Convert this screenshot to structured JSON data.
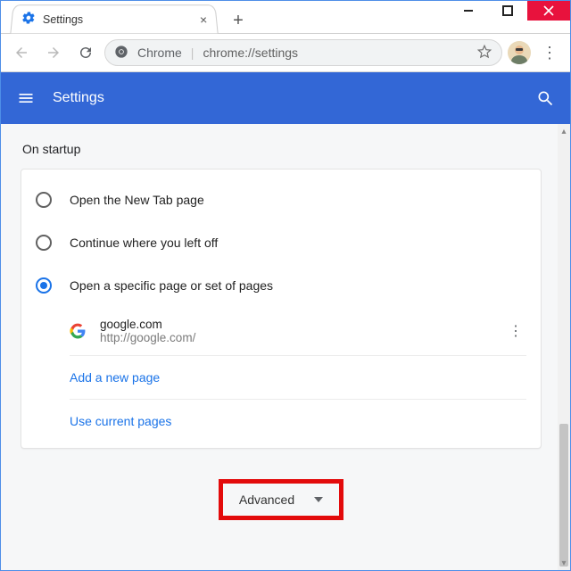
{
  "window": {
    "tab_title": "Settings"
  },
  "omnibox": {
    "scheme_label": "Chrome",
    "url": "chrome://settings"
  },
  "header": {
    "title": "Settings"
  },
  "section": {
    "title": "On startup",
    "options": [
      "Open the New Tab page",
      "Continue where you left off",
      "Open a specific page or set of pages"
    ],
    "startup_page": {
      "name": "google.com",
      "url": "http://google.com/"
    },
    "add_page": "Add a new page",
    "use_current": "Use current pages"
  },
  "advanced_label": "Advanced"
}
